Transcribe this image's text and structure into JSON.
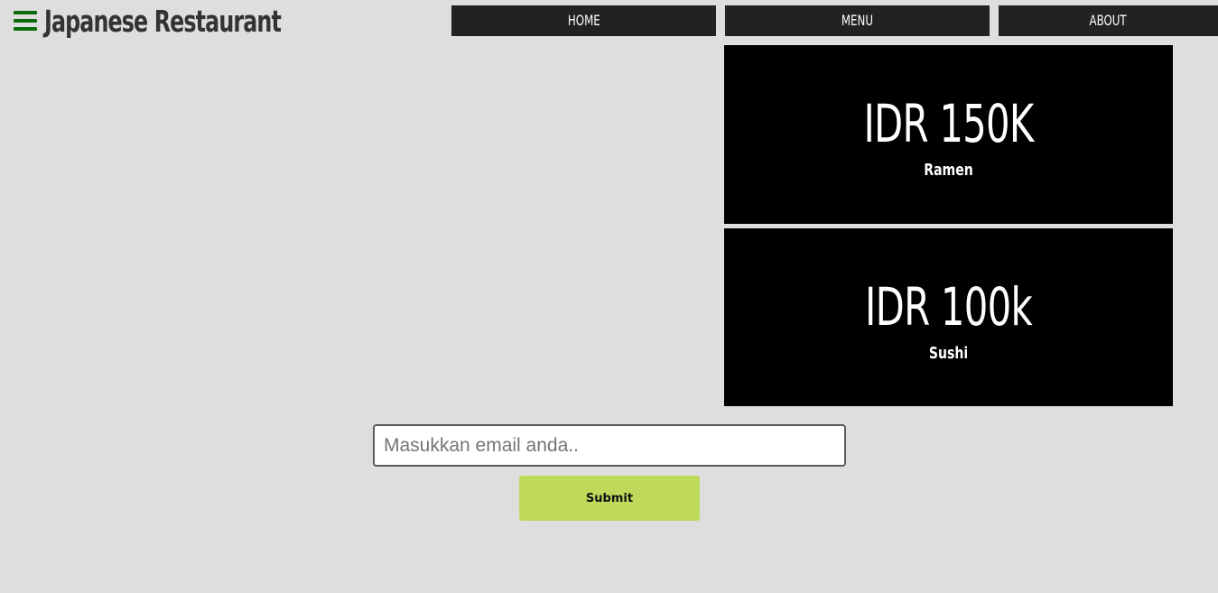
{
  "header": {
    "brand": "Japanese Restaurant",
    "menu_icon": "hamburger-icon",
    "menu_icon_color": "#0a6b0a"
  },
  "nav": {
    "home": "HOME",
    "menu": "MENU",
    "about": "ABOUT"
  },
  "menu_items": [
    {
      "price": "IDR 150K",
      "name": "Ramen"
    },
    {
      "price": "IDR 100k",
      "name": "Sushi"
    }
  ],
  "subscribe": {
    "email_placeholder": "Masukkan email anda..",
    "email_value": "",
    "submit_label": "Submit",
    "submit_color": "#bfda5a"
  },
  "colors": {
    "background": "#dedede",
    "nav_background": "#222222",
    "card_background": "#000000"
  }
}
